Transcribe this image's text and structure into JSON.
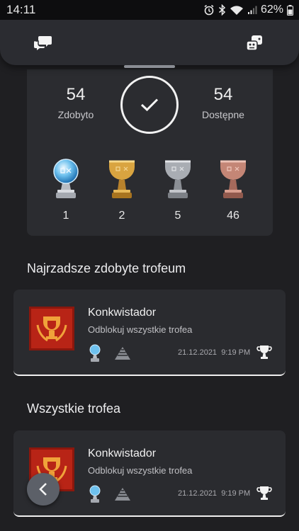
{
  "status_bar": {
    "time": "14:11",
    "battery": "62%"
  },
  "header": {
    "left_icon": "chat-bubbles-icon",
    "right_icon": "game-pad-icon"
  },
  "summary": {
    "earned_count": "54",
    "earned_label": "Zdobyto",
    "available_count": "54",
    "available_label": "Dostępne",
    "trophy_counts": {
      "platinum": "1",
      "gold": "2",
      "silver": "5",
      "bronze": "46"
    }
  },
  "rarest_section": {
    "title": "Najrzadsze zdobyte trofeum",
    "card": {
      "name": "Konkwistador",
      "description": "Odblokuj wszystkie trofea",
      "date": "21.12.2021",
      "time": "9:19 PM"
    }
  },
  "all_section": {
    "title": "Wszystkie trofea",
    "card": {
      "name": "Konkwistador",
      "description": "Odblokuj wszystkie trofea",
      "date": "21.12.2021",
      "time": "9:19 PM"
    }
  },
  "colors": {
    "background": "#1f1f22",
    "card": "#2b2c30",
    "platinum": "#8fd0f5",
    "gold": "#d9a440",
    "silver": "#b5b8bd",
    "bronze": "#c98d7d",
    "thumb_red": "#b82416"
  }
}
